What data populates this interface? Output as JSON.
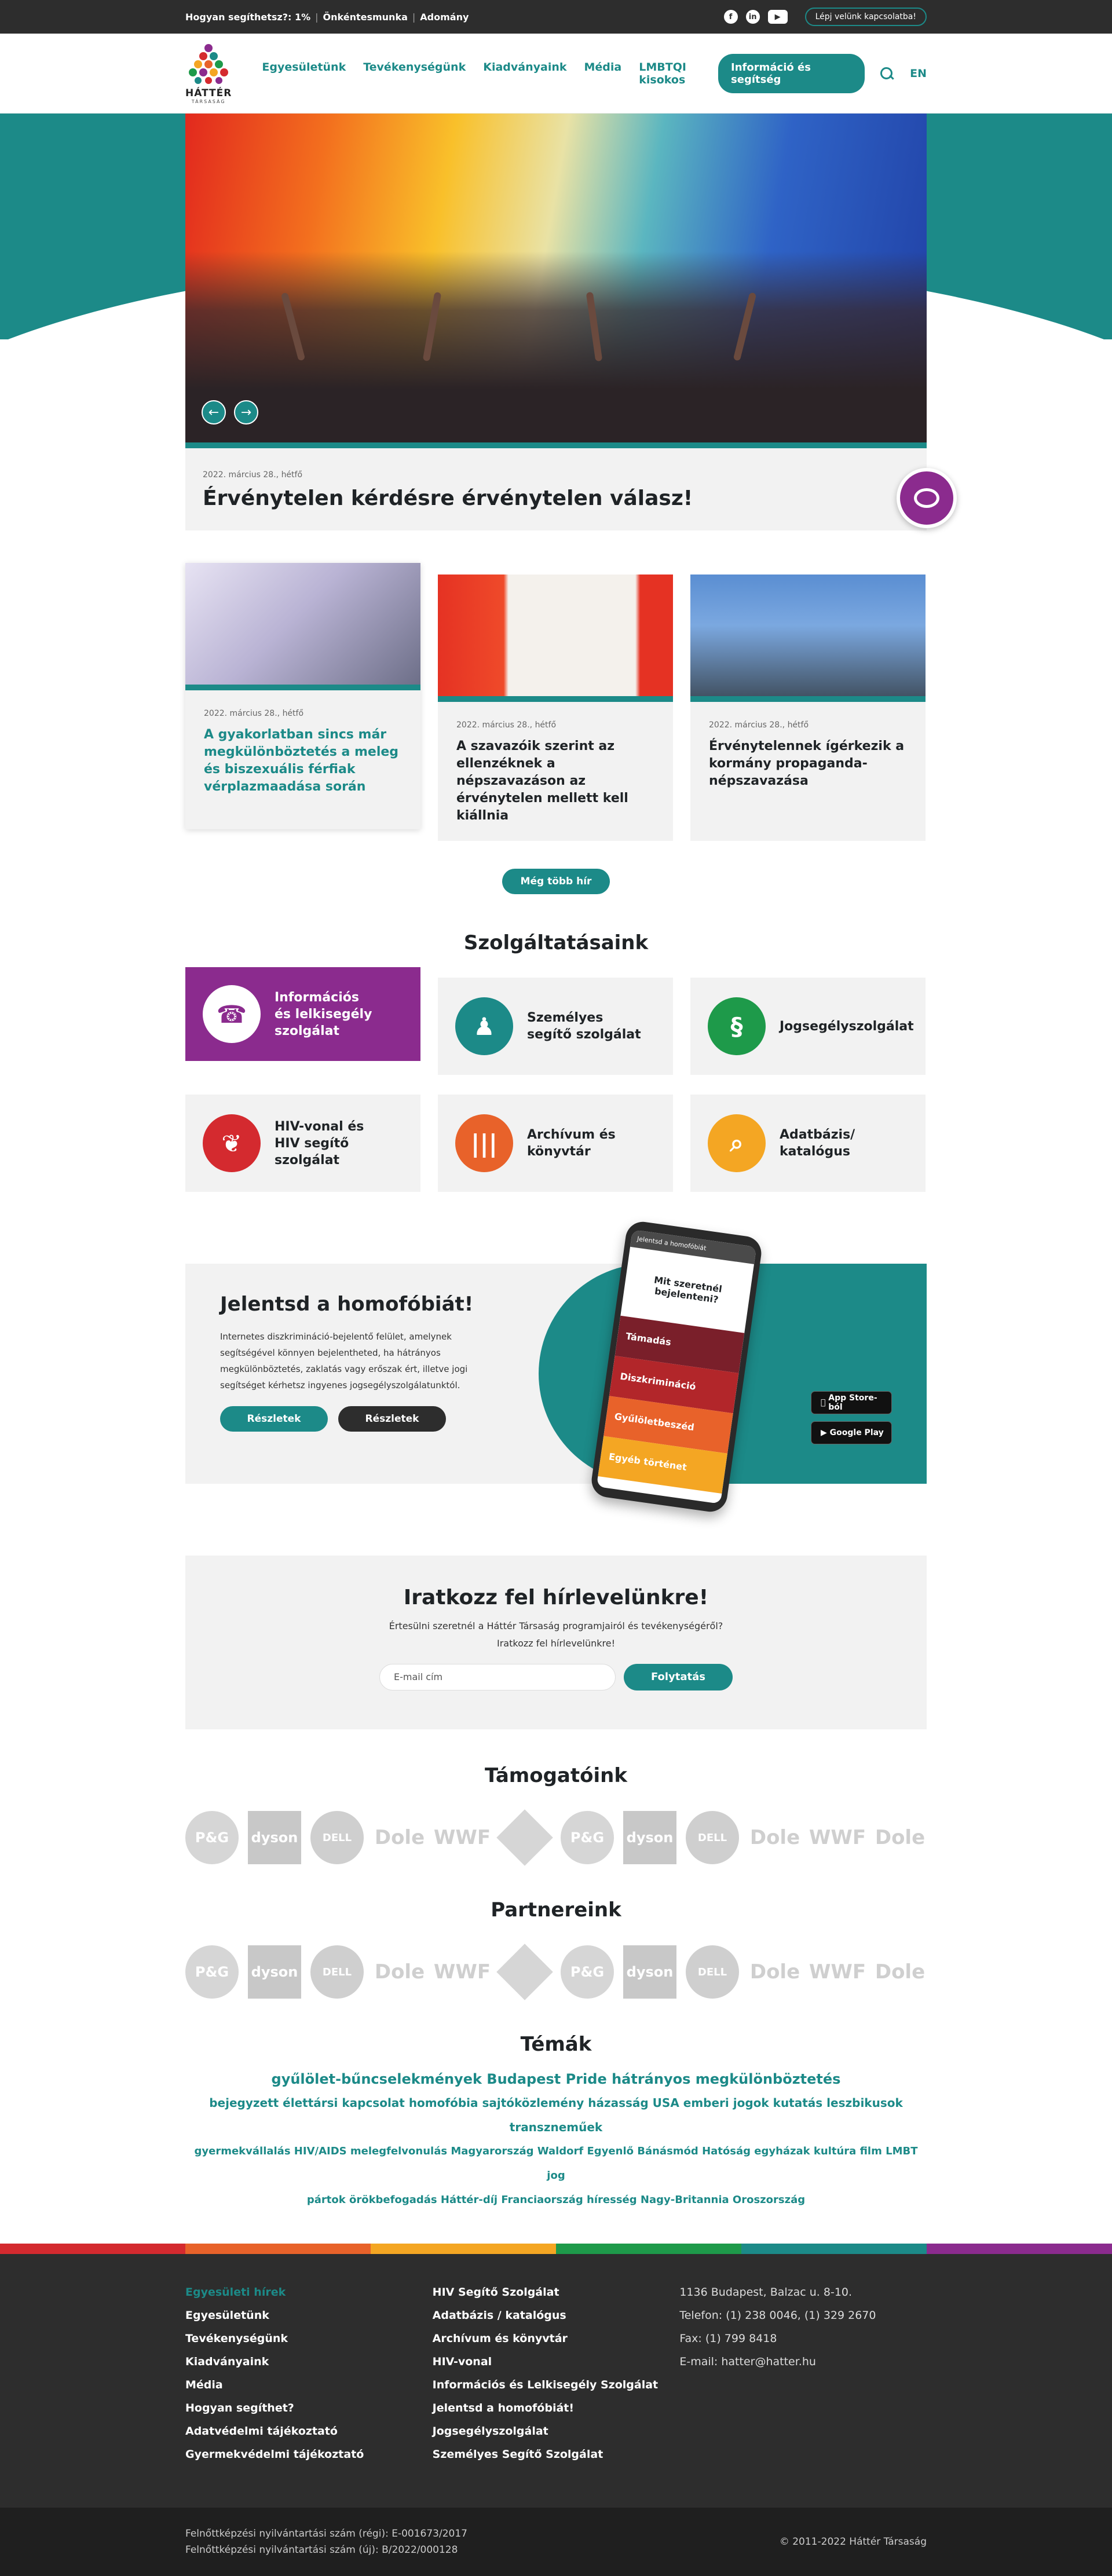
{
  "topbar": {
    "links": [
      "Hogyan segíthetsz?: 1%",
      "Önkéntesmunka",
      "Adomány"
    ],
    "contact": "Lépj velünk kapcsolatba!",
    "social": [
      "facebook-icon",
      "linkedin-icon",
      "youtube-icon"
    ]
  },
  "header": {
    "logo_text": "HÁTTÉR",
    "logo_sub": "TÁRSASÁG",
    "nav": [
      "Egyesületünk",
      "Tevékenységünk",
      "Kiadványaink",
      "Média",
      "LMBTQI kisokos"
    ],
    "info_button": "Információ és segítség",
    "lang": "EN"
  },
  "hero": {
    "date": "2022. március 28., hétfő",
    "title": "Érvénytelen kérdésre érvénytelen válasz!"
  },
  "news": [
    {
      "date": "2022. március 28., hétfő",
      "title": "A gyakorlatban sincs már megkülönböztetés a meleg és biszexuális férfiak vérplazmaadása során"
    },
    {
      "date": "2022. március 28., hétfő",
      "title": "A szavazóik szerint az ellenzéknek a népszavazáson az érvénytelen mellett kell kiállnia"
    },
    {
      "date": "2022. március 28., hétfő",
      "title": "Érvénytelennek ígérkezik a kormány propaganda-népszavazása"
    }
  ],
  "more_news": "Még több hír",
  "services": {
    "title": "Szolgáltatásaink",
    "items": [
      {
        "label": "Információs\nés lelkisegély\nszolgálat",
        "icon": "phone-icon",
        "glyph": "☎",
        "color": "#8b2b8e"
      },
      {
        "label": "Személyes\nsegítő szolgálat",
        "icon": "person-icon",
        "glyph": "♟",
        "color": "#1c8a88"
      },
      {
        "label": "Jogsegélyszolgálat",
        "icon": "paragraph-icon",
        "glyph": "§",
        "color": "#1e9a4a"
      },
      {
        "label": "HIV-vonal és\nHIV segítő szolgálat",
        "icon": "ribbon-icon",
        "glyph": "❦",
        "color": "#d42a2f"
      },
      {
        "label": "Archívum és\nkönyvtár",
        "icon": "books-icon",
        "glyph": "|||",
        "color": "#e8622a"
      },
      {
        "label": "Adatbázis/\nkatalógus",
        "icon": "magnifier-icon",
        "glyph": "⌕",
        "color": "#f4a623"
      }
    ]
  },
  "report": {
    "title": "Jelentsd a homofóbiát!",
    "text": "Internetes diszkrimináció-bejelentő felület, amelynek segítségével könnyen bejelentheted, ha hátrányos megkülönböztetés, zaklatás vagy erőszak ért, illetve jogi segítséget kérhetsz ingyenes jogsegélyszolgálatunktól.",
    "buttons": [
      "Részletek",
      "Részletek"
    ],
    "phone": {
      "bar": "Jelentsd a homofóbiát",
      "question": "Mit szeretnél bejelenteni?",
      "options": [
        "Támadás",
        "Diszkrimináció",
        "Gyűlöletbeszéd",
        "Egyéb történet"
      ]
    },
    "stores": [
      "App Store-ból",
      "Google Play"
    ]
  },
  "newsletter": {
    "title": "Iratkozz fel hírlevelünkre!",
    "text": "Értesülni szeretnél a Háttér Társaság programjairól és tevékenységéről?\nIratkozz fel hírlevelünkre!",
    "placeholder": "E-mail cím",
    "button": "Folytatás"
  },
  "supporters_title": "Támogatóink",
  "partners_title": "Partnereink",
  "logos": [
    "P&G",
    "dyson",
    "DELL",
    "Dole",
    "WWF",
    "",
    "P&G",
    "dyson",
    "DELL",
    "Dole",
    "WWF",
    "Dole"
  ],
  "themes": {
    "title": "Témák",
    "line1": "gyűlölet-bűncselekmények Budapest Pride hátrányos megkülönböztetés",
    "line2": "bejegyzett élettársi kapcsolat homofóbia sajtóközlemény házasság USA emberi jogok kutatás leszbikusok transzneműek",
    "line3": "gyermekvállalás HIV/AIDS melegfelvonulás Magyarország Waldorf Egyenlő Bánásmód Hatóság egyházak kultúra film LMBT jog",
    "line4": "pártok örökbefogadás Háttér-díj Franciaország híresség Nagy-Britannia Oroszország"
  },
  "rainbow": [
    "#d42a2f",
    "#e8622a",
    "#f4a623",
    "#1e9a4a",
    "#1c8a88",
    "#8b2b8e"
  ],
  "footer": {
    "col1": [
      "Egyesületi hírek",
      "Egyesületünk",
      "Tevékenységünk",
      "Kiadványaink",
      "Média",
      "Hogyan segíthet?",
      "Adatvédelmi tájékoztató",
      "Gyermekvédelmi tájékoztató"
    ],
    "col2": [
      "HIV Segítő Szolgálat",
      "Adatbázis / katalógus",
      "Archívum és könyvtár",
      "HIV-vonal",
      "Információs és Lelkisegély Szolgálat",
      "Jelentsd a homofóbiát!",
      "Jogsegélyszolgálat",
      "Személyes Segítő Szolgálat"
    ],
    "col3": [
      "1136 Budapest, Balzac u. 8-10.",
      "Telefon: (1) 238 0046, (1) 329 2670",
      "Fax: (1) 799 8418",
      "E-mail: hatter@hatter.hu"
    ],
    "reg1": "Felnőttképzési nyilvántartási szám (régi): E-001673/2017",
    "reg2": "Felnőttképzési nyilvántartási szám (új): B/2022/000128",
    "copyright": "© 2011-2022 Háttér Társaság"
  }
}
